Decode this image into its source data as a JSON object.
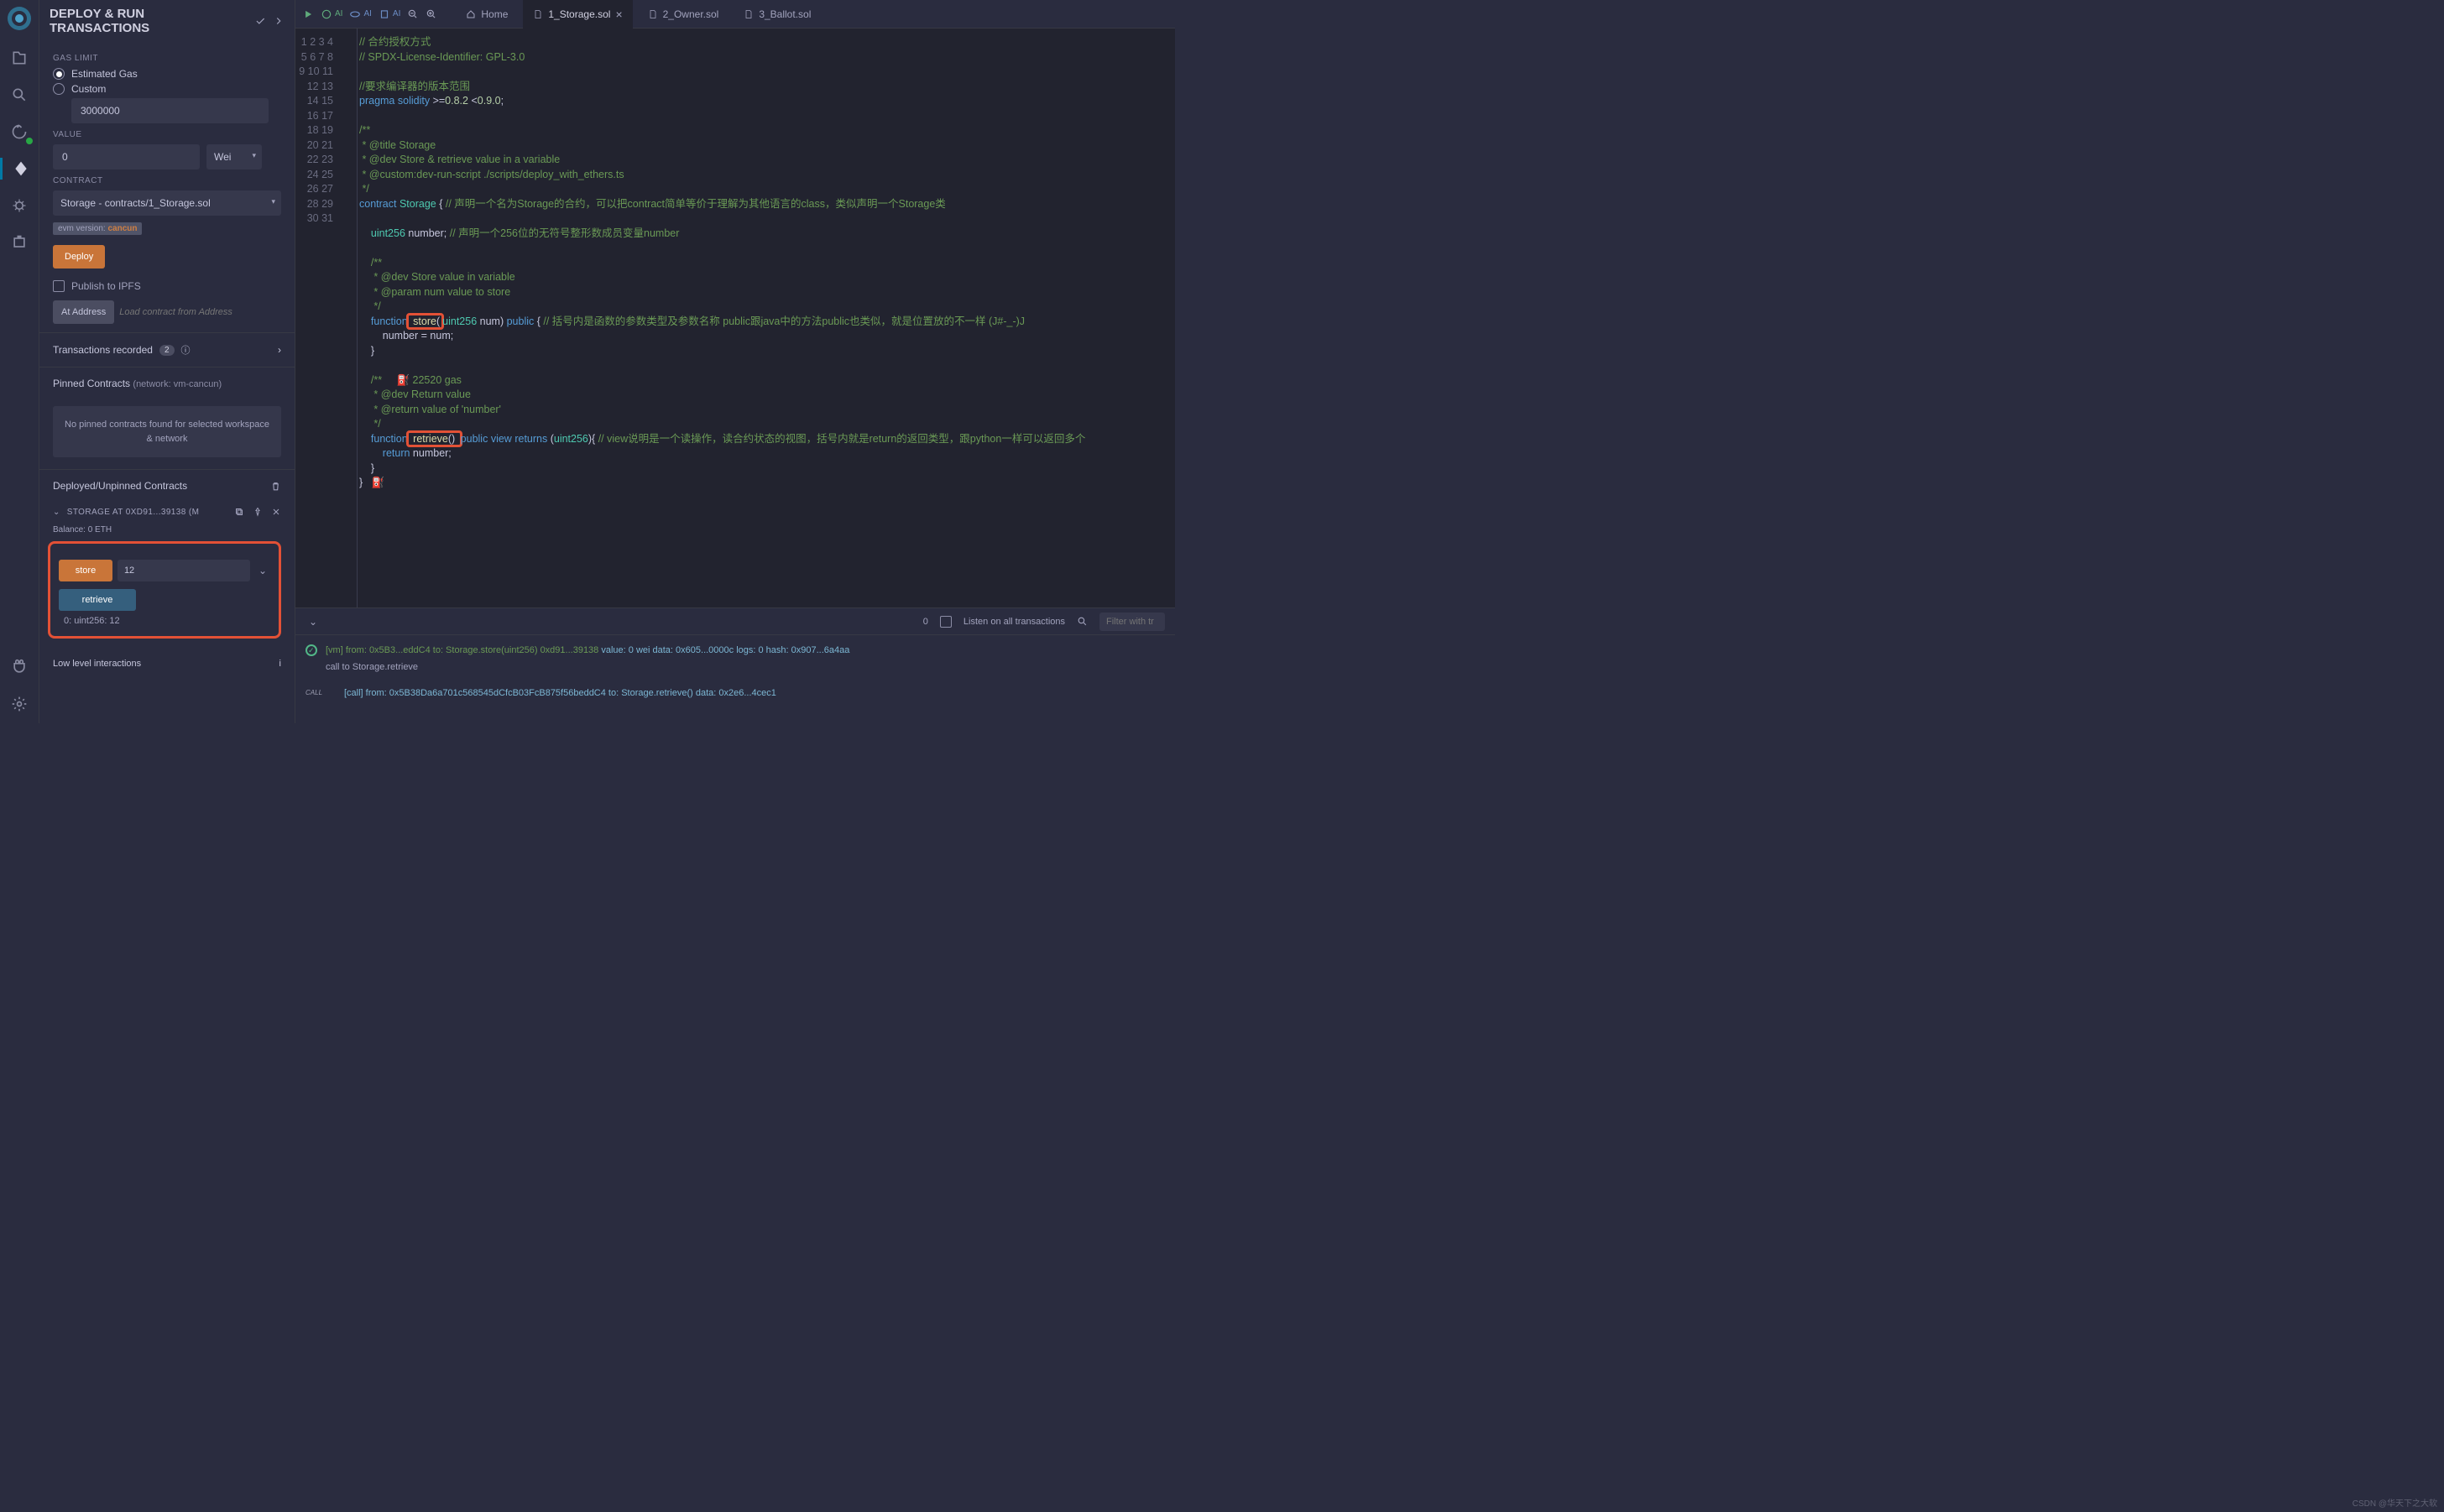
{
  "panel": {
    "title": "DEPLOY & RUN TRANSACTIONS",
    "gas_limit_label": "GAS LIMIT",
    "gas_estimated": "Estimated Gas",
    "gas_custom": "Custom",
    "gas_value": "3000000",
    "value_label": "VALUE",
    "value_amount": "0",
    "value_unit": "Wei",
    "contract_label": "CONTRACT",
    "contract_selected": "Storage - contracts/1_Storage.sol",
    "evm_prefix": "evm version: ",
    "evm_version": "cancun",
    "deploy": "Deploy",
    "publish_ipfs": "Publish to IPFS",
    "at_address": "At Address",
    "at_address_placeholder": "Load contract from Address",
    "tx_recorded": "Transactions recorded",
    "tx_count": "2",
    "pinned_title": "Pinned Contracts",
    "pinned_net": "(network: vm-cancun)",
    "no_pinned": "No pinned contracts found for selected workspace & network",
    "deployed_title": "Deployed/Unpinned Contracts",
    "contract_name": "STORAGE AT 0XD91...39138 (M",
    "balance": "Balance: 0 ETH",
    "fn_store": "store",
    "fn_store_arg": "12",
    "fn_retrieve": "retrieve",
    "retrieve_result": "0: uint256: 12",
    "low_level": "Low level interactions"
  },
  "tabs": {
    "home": "Home",
    "files": [
      "1_Storage.sol",
      "2_Owner.sol",
      "3_Ballot.sol"
    ],
    "ai": "AI"
  },
  "code_lines": 31,
  "terminal": {
    "pending_count": "0",
    "listen": "Listen on all transactions",
    "filter_placeholder": "Filter with tr",
    "line1_pre": "[vm] from: 0x5B3...eddC4 to: Storage.store(uint256) 0xd91...39138 ",
    "line1_val": "value: 0 wei ",
    "line1_data": "data: 0x605...0000c ",
    "line1_logs": "logs: 0 ",
    "line1_hash": "hash: 0x907...6a4aa",
    "line2": "call to Storage.retrieve",
    "call_tag": "CALL",
    "line3": "[call] from: 0x5B38Da6a701c568545dCfcB03FcB875f56beddC4 to: Storage.retrieve() data: 0x2e6...4cec1"
  },
  "watermark": "CSDN @华天下之大软"
}
